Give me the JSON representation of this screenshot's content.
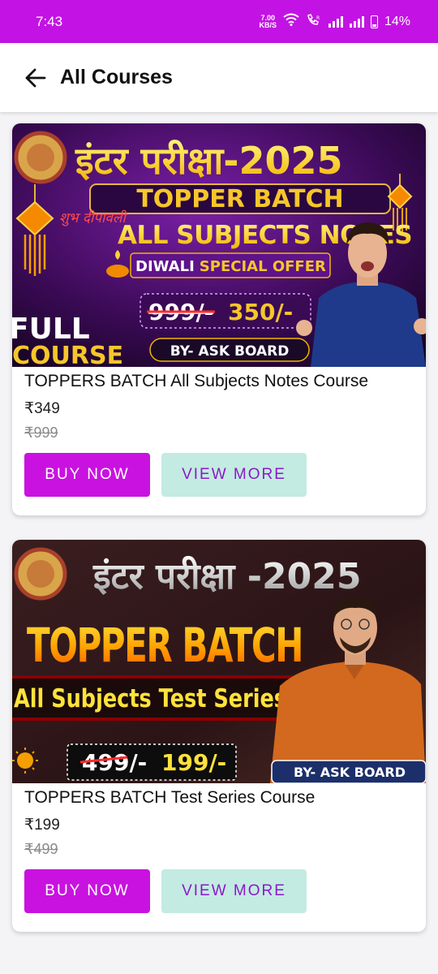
{
  "status_bar": {
    "time": "7:43",
    "net_speed": "7.00",
    "net_unit": "KB/S",
    "battery": "14%"
  },
  "app_bar": {
    "title": "All Courses"
  },
  "colors": {
    "status_bar": "#c313e4",
    "buy_button": "#c912e0",
    "view_button": "#c3ebe2",
    "view_text": "#8a18c8"
  },
  "courses": [
    {
      "title": "TOPPERS BATCH All Subjects Notes Course",
      "price": "₹349",
      "mrp": "₹999",
      "buy_label": "BUY NOW",
      "view_label": "VIEW MORE",
      "banner": {
        "heading": "इंटर परीक्षा-2025",
        "tag": "TOPPER BATCH",
        "subtitle": "ALL SUBJECTS NOTES",
        "offer_prefix": "DIWALI",
        "offer_suffix": "SPECIAL OFFER",
        "festival": "शुभ दीपावली",
        "old_price": "999/-",
        "new_price": "350/-",
        "badge_line1": "FULL",
        "badge_line2": "COURSE",
        "by": "BY- ASK BOARD"
      }
    },
    {
      "title": "TOPPERS BATCH Test Series Course",
      "price": "₹199",
      "mrp": "₹499",
      "buy_label": "BUY NOW",
      "view_label": "VIEW MORE",
      "banner": {
        "heading": "इंटर परीक्षा -2025",
        "tag": "TOPPER BATCH",
        "subtitle": "All Subjects Test Series",
        "old_price": "499/-",
        "new_price": "199/-",
        "by": "BY- ASK BOARD"
      }
    }
  ]
}
